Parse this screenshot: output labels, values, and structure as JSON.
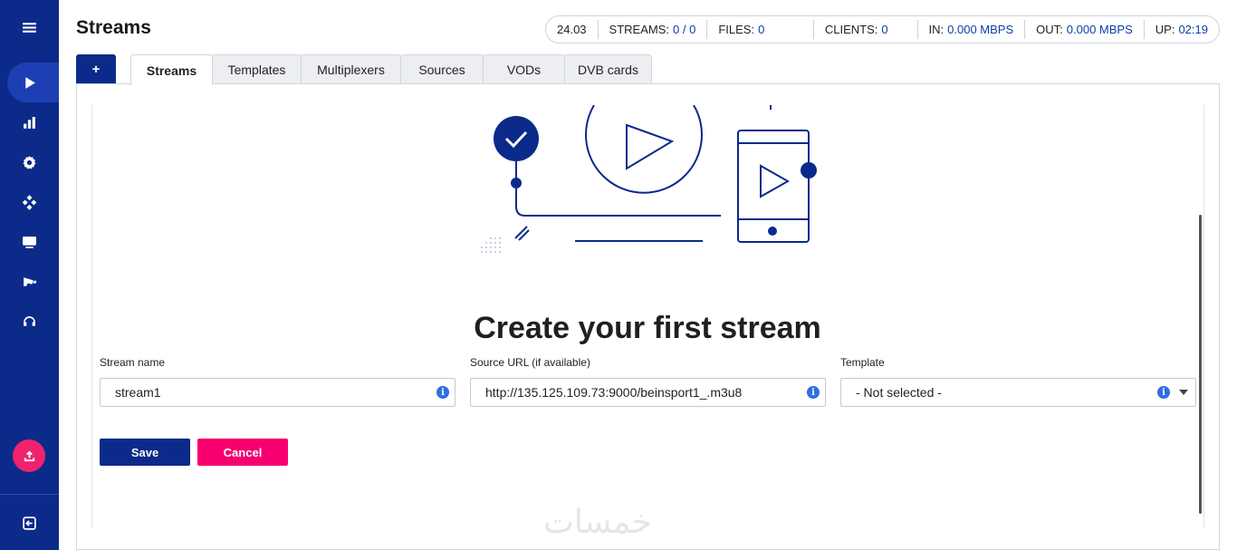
{
  "page": {
    "title": "Streams"
  },
  "status": {
    "version": "24.03",
    "streams_label": "STREAMS:",
    "streams_value": "0 / 0",
    "files_label": "FILES:",
    "files_value": "0",
    "clients_label": "CLIENTS:",
    "clients_value": "0",
    "in_label": "IN:",
    "in_value": "0.000 MBPS",
    "out_label": "OUT:",
    "out_value": "0.000 MBPS",
    "up_label": "UP:",
    "up_value": "02:19"
  },
  "tabs": {
    "add_label": "+",
    "items": [
      {
        "label": "Streams",
        "active": true
      },
      {
        "label": "Templates"
      },
      {
        "label": "Multiplexers"
      },
      {
        "label": "Sources"
      },
      {
        "label": "VODs"
      },
      {
        "label": "DVB cards"
      }
    ]
  },
  "main": {
    "headline": "Create your first stream",
    "stream_name": {
      "label": "Stream name",
      "value": "stream1"
    },
    "source_url": {
      "label": "Source URL (if available)",
      "value": "http://135.125.109.73:9000/beinsport1_.m3u8"
    },
    "template": {
      "label": "Template",
      "value": "- Not selected -"
    },
    "save_label": "Save",
    "cancel_label": "Cancel",
    "info_glyph": "i"
  },
  "watermark": "خمسات",
  "colors": {
    "sidebar": "#0b2a8a",
    "primary": "#0b2a8a",
    "accent": "#f5006e",
    "link": "#0b3ea8"
  },
  "icons": [
    "menu-icon",
    "play-icon",
    "bar-chart-icon",
    "gear-icon",
    "network-icon",
    "monitor-icon",
    "camera-icon",
    "headset-icon",
    "upload-icon",
    "logout-icon"
  ]
}
